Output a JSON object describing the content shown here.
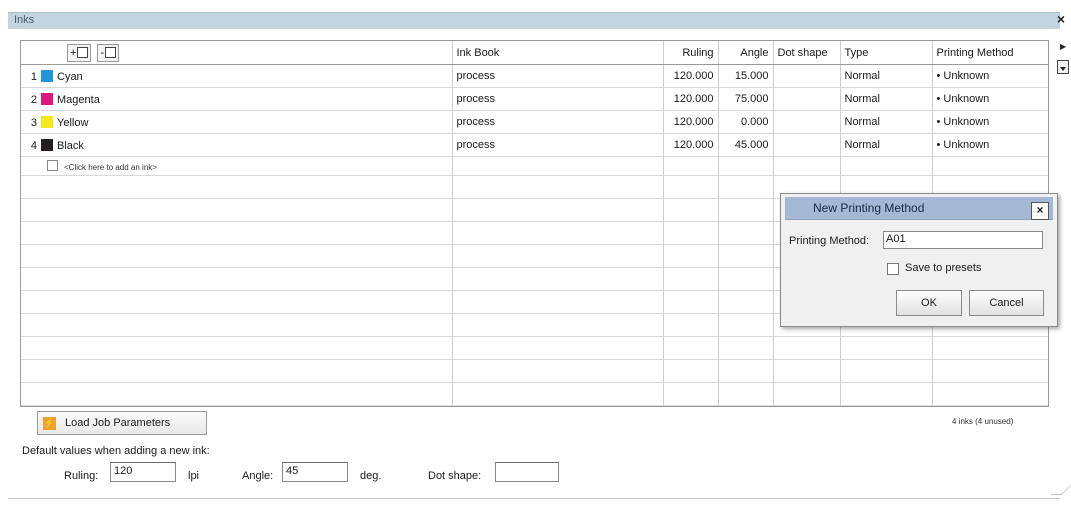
{
  "window": {
    "title": "Inks",
    "close_glyph": "×"
  },
  "grid": {
    "add_button_label": "+",
    "remove_button_label": "-",
    "headers": {
      "ink_book": "Ink Book",
      "ruling": "Ruling",
      "angle": "Angle",
      "dot_shape": "Dot shape",
      "type": "Type",
      "printing_method": "Printing Method"
    },
    "inks": [
      {
        "index": "1",
        "name": "Cyan",
        "color": "#1e96d9",
        "ink_book": "process",
        "ruling": "120.000",
        "angle": "15.000",
        "dot_shape": "",
        "type": "Normal",
        "printing_method": "• Unknown"
      },
      {
        "index": "2",
        "name": "Magenta",
        "color": "#e0147f",
        "ink_book": "process",
        "ruling": "120.000",
        "angle": "75.000",
        "dot_shape": "",
        "type": "Normal",
        "printing_method": "• Unknown"
      },
      {
        "index": "3",
        "name": "Yellow",
        "color": "#f7e81c",
        "ink_book": "process",
        "ruling": "120.000",
        "angle": "0.000",
        "dot_shape": "",
        "type": "Normal",
        "printing_method": "• Unknown"
      },
      {
        "index": "4",
        "name": "Black",
        "color": "#231f20",
        "ink_book": "process",
        "ruling": "120.000",
        "angle": "45.000",
        "dot_shape": "",
        "type": "Normal",
        "printing_method": "• Unknown"
      }
    ],
    "add_ink_text": "<Click here to add an ink>"
  },
  "footer": {
    "load_button_label": "Load Job Parameters",
    "inks_count": "4 inks (4 unused)",
    "defaults_label": "Default values when adding a new ink:",
    "ruling_label": "Ruling:",
    "ruling_value": "120",
    "ruling_unit": "lpi",
    "angle_label": "Angle:",
    "angle_value": "45",
    "angle_unit": "deg.",
    "dot_shape_label": "Dot shape:",
    "dot_shape_value": ""
  },
  "dialog": {
    "title": "New Printing Method",
    "close_glyph": "×",
    "method_label": "Printing Method:",
    "method_value": "A01",
    "save_presets_label": "Save to presets",
    "save_presets_checked": false,
    "ok_label": "OK",
    "cancel_label": "Cancel"
  }
}
